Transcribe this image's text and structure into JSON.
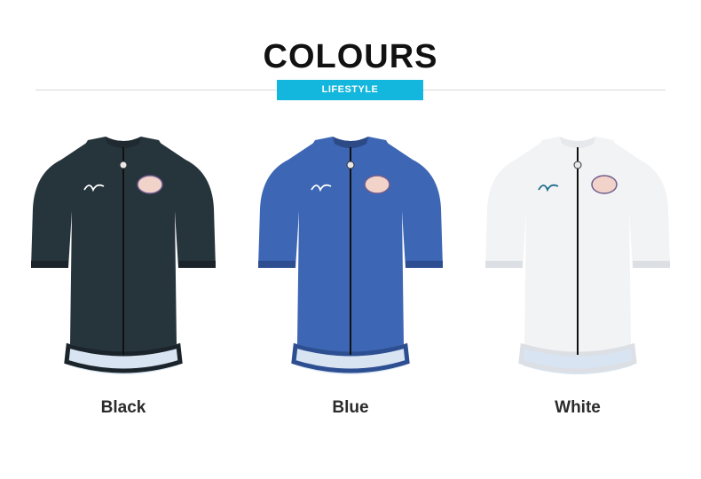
{
  "header": {
    "title": "COLOURS",
    "badge": "LIFESTYLE"
  },
  "products": [
    {
      "name": "Black",
      "body": "#26343c",
      "dark": "#1a242a",
      "collar": "#1f2a30"
    },
    {
      "name": "Blue",
      "body": "#3d66b4",
      "dark": "#2d4f92",
      "collar": "#2b4a86"
    },
    {
      "name": "White",
      "body": "#f2f3f5",
      "dark": "#dcdfe4",
      "collar": "#e6e8eb"
    }
  ]
}
